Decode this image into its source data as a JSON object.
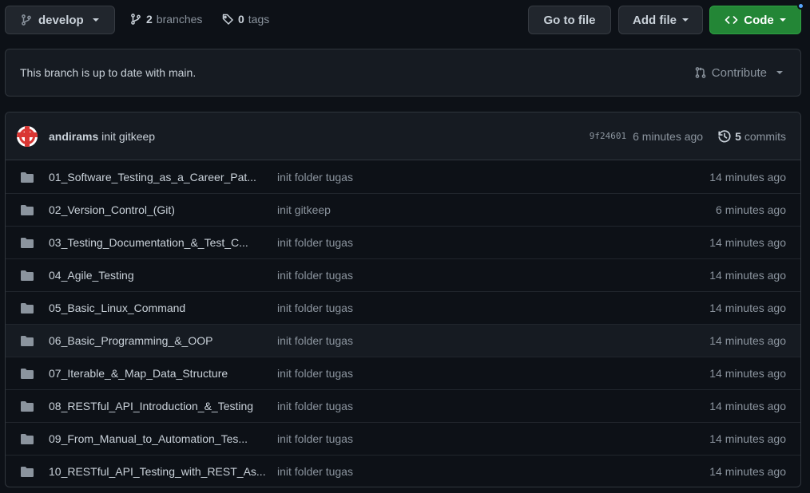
{
  "topbar": {
    "branch": "develop",
    "branches_count": "2",
    "branches_label": "branches",
    "tags_count": "0",
    "tags_label": "tags",
    "goto_file": "Go to file",
    "add_file": "Add file",
    "code": "Code"
  },
  "branch_info": {
    "status": "This branch is up to date with main.",
    "contribute": "Contribute"
  },
  "latest_commit": {
    "author": "andirams",
    "message": "init gitkeep",
    "sha": "9f24601",
    "time": "6 minutes ago",
    "commits_count": "5",
    "commits_label": "commits"
  },
  "files": [
    {
      "name": "01_Software_Testing_as_a_Career_Pat...",
      "commit": "init folder tugas",
      "time": "14 minutes ago"
    },
    {
      "name": "02_Version_Control_(Git)",
      "commit": "init gitkeep",
      "time": "6 minutes ago"
    },
    {
      "name": "03_Testing_Documentation_&_Test_C...",
      "commit": "init folder tugas",
      "time": "14 minutes ago"
    },
    {
      "name": "04_Agile_Testing",
      "commit": "init folder tugas",
      "time": "14 minutes ago"
    },
    {
      "name": "05_Basic_Linux_Command",
      "commit": "init folder tugas",
      "time": "14 minutes ago"
    },
    {
      "name": "06_Basic_Programming_&_OOP",
      "commit": "init folder tugas",
      "time": "14 minutes ago"
    },
    {
      "name": "07_Iterable_&_Map_Data_Structure",
      "commit": "init folder tugas",
      "time": "14 minutes ago"
    },
    {
      "name": "08_RESTful_API_Introduction_&_Testing",
      "commit": "init folder tugas",
      "time": "14 minutes ago"
    },
    {
      "name": "09_From_Manual_to_Automation_Tes...",
      "commit": "init folder tugas",
      "time": "14 minutes ago"
    },
    {
      "name": "10_RESTful_API_Testing_with_REST_As...",
      "commit": "init folder tugas",
      "time": "14 minutes ago"
    }
  ],
  "icons": {
    "branch": "git-branch-icon",
    "tag": "tag-icon",
    "pull_request": "git-pull-request-icon",
    "history": "history-icon",
    "folder": "folder-icon",
    "code": "code-icon"
  },
  "colors": {
    "background": "#0d1117",
    "surface": "#161b22",
    "border": "#30363d",
    "text": "#c9d1d9",
    "muted": "#8b949e",
    "code_button": "#238636",
    "folder": "#8b949e",
    "notification": "#58a6ff"
  }
}
